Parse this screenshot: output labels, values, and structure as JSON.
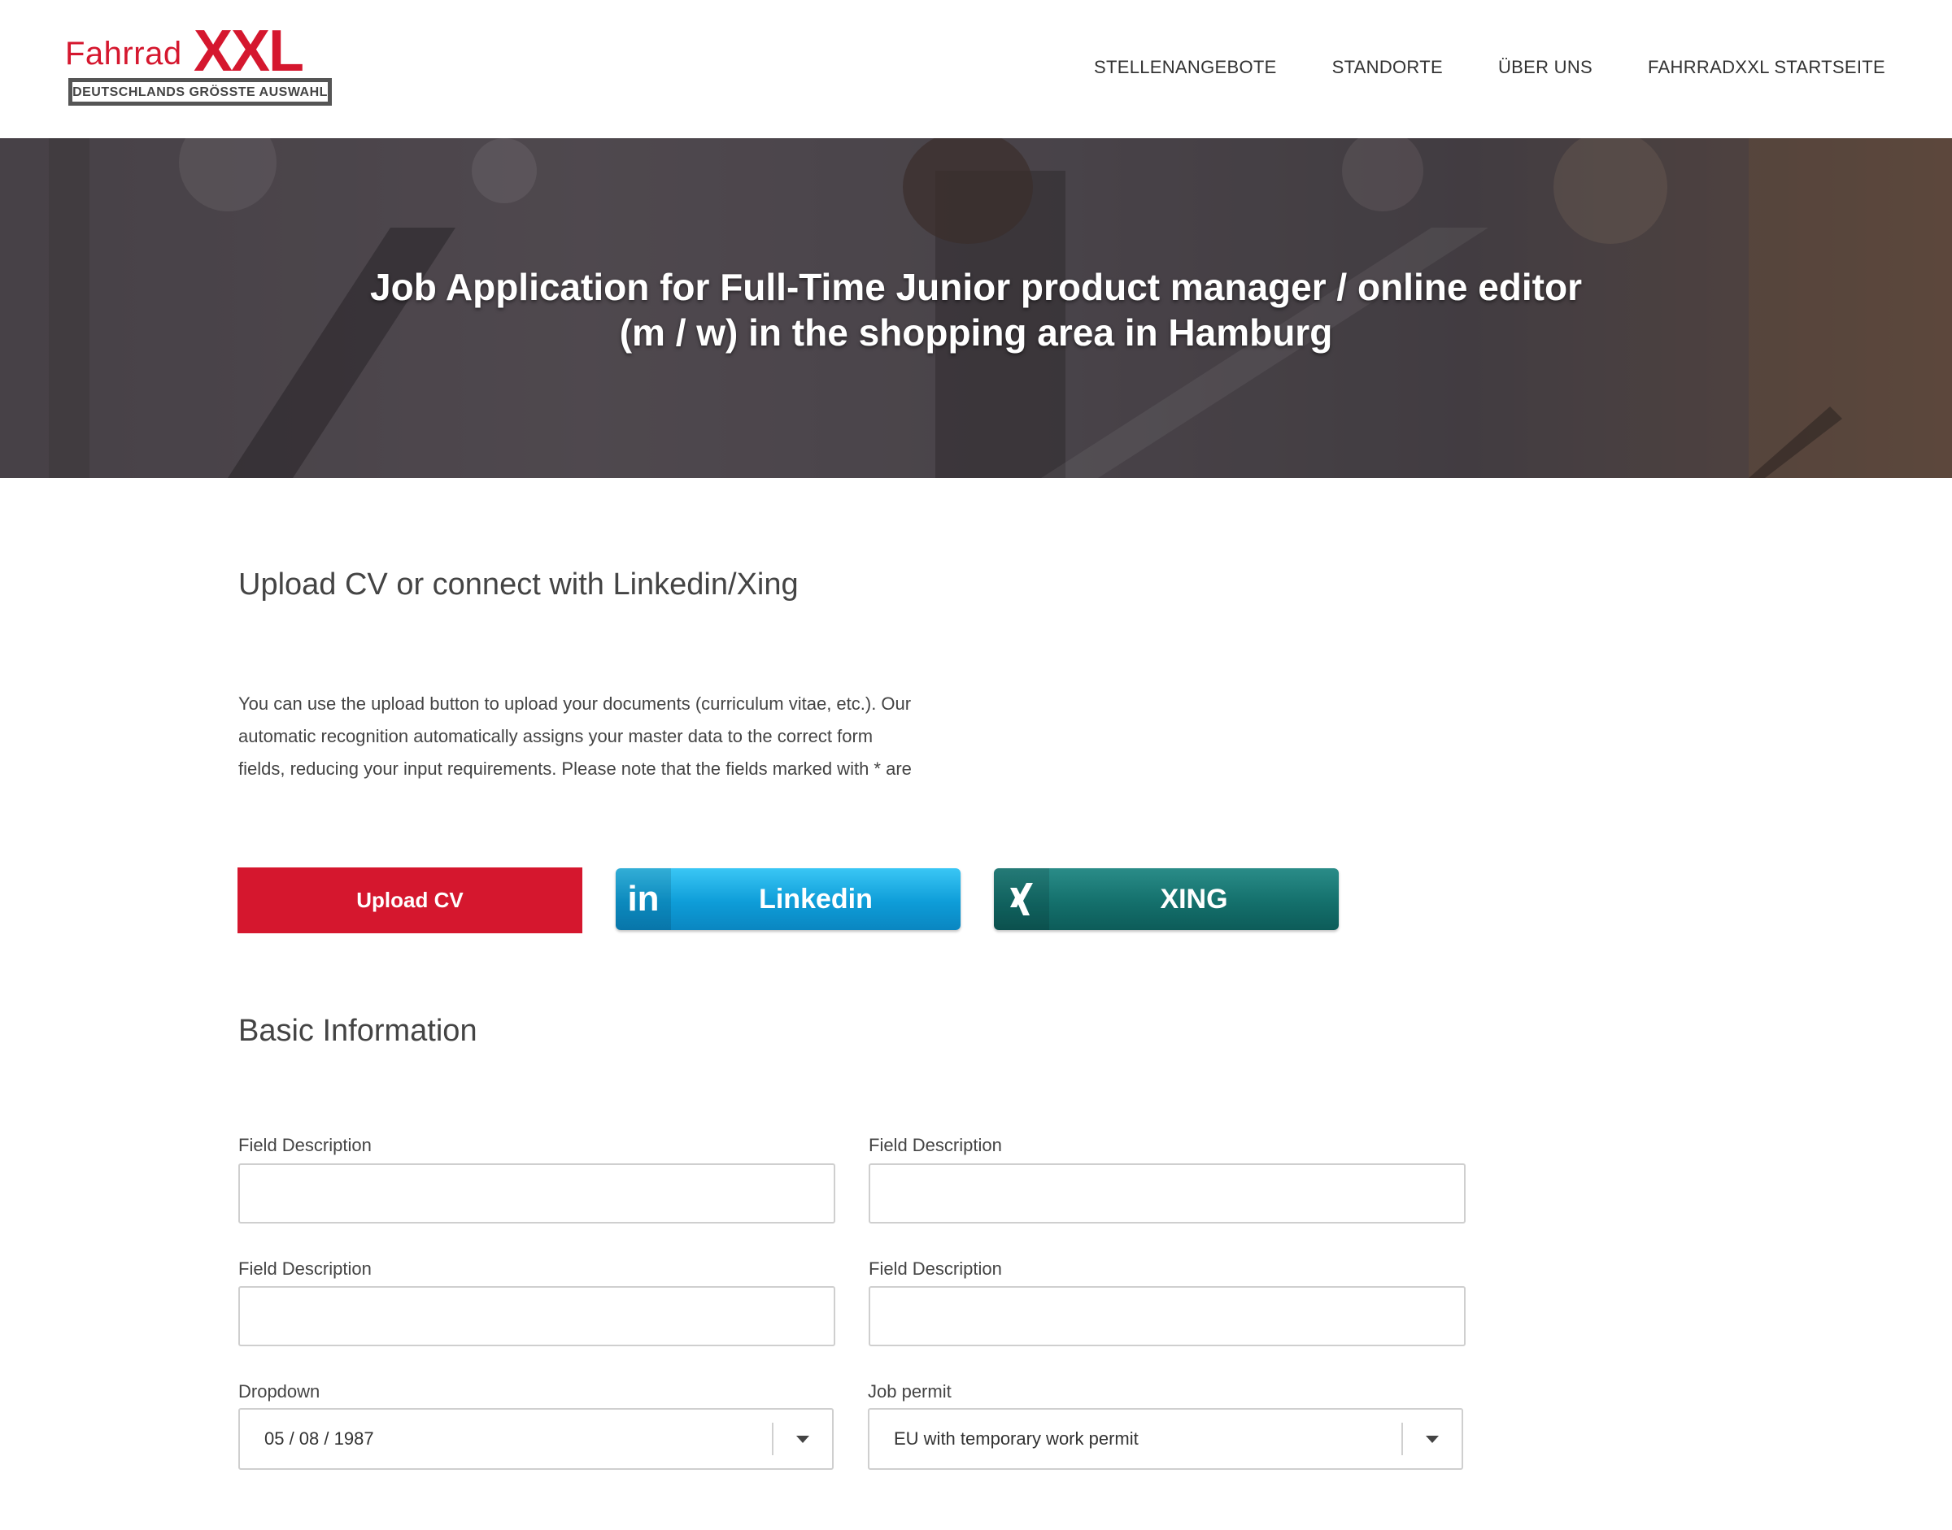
{
  "brand": {
    "word": "Fahrrad",
    "xxl": "XXL",
    "tagline": "DEUTSCHLANDS GRÖSSTE AUSWAHL",
    "color": "#d5172e"
  },
  "nav": {
    "items": [
      {
        "label": "STELLENANGEBOTE"
      },
      {
        "label": "STANDORTE"
      },
      {
        "label": "ÜBER UNS"
      },
      {
        "label": "FAHRRADXXL STARTSEITE"
      }
    ]
  },
  "hero": {
    "title_line1": "Job Application for Full-Time Junior product manager / online editor",
    "title_line2": "(m / w) in the shopping area in Hamburg"
  },
  "upload_section": {
    "title": "Upload CV or connect with Linkedin/Xing",
    "intro_line1": "You can use the upload button to upload your documents (curriculum vitae, etc.). Our",
    "intro_line2": "automatic recognition automatically assigns your master data to the correct form",
    "intro_line3": "fields, reducing your input requirements. Please note that the fields marked with * are",
    "upload_label": "Upload CV",
    "linkedin_label": "Linkedin",
    "linkedin_icon": "in",
    "linkedin_color": "#0e9dd8",
    "xing_label": "XING",
    "xing_icon": "X",
    "xing_color": "#14706c"
  },
  "basic_info": {
    "title": "Basic Information",
    "fields": [
      {
        "label": "Field Description",
        "value": ""
      },
      {
        "label": "Field Description",
        "value": ""
      },
      {
        "label": "Field Description",
        "value": ""
      },
      {
        "label": "Field Description",
        "value": ""
      }
    ],
    "dropdown": {
      "label": "Dropdown",
      "value": "05 / 08 / 1987"
    },
    "job_permit": {
      "label": "Job permit",
      "value": "EU with temporary work permit"
    }
  }
}
